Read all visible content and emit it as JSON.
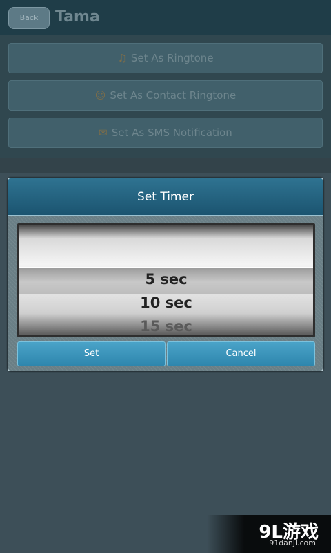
{
  "background": {
    "back_label": "Back",
    "title": "Tama",
    "buttons": [
      {
        "label": "Set As Ringtone",
        "icon": "ringtone-icon"
      },
      {
        "label": "Set As Contact Ringtone",
        "icon": "contact-icon"
      },
      {
        "label": "Set As SMS Notification",
        "icon": "sms-icon"
      }
    ]
  },
  "dialog": {
    "title": "Set Timer",
    "picker": {
      "items": [
        "",
        "5 sec",
        "10 sec",
        "15 sec"
      ],
      "selected": "5 sec"
    },
    "set_label": "Set",
    "cancel_label": "Cancel"
  },
  "watermark": {
    "logo": "9L游戏",
    "site": "91danji.com"
  },
  "colors": {
    "dialog_header": "#1b5470",
    "button_accent": "#2e86ad",
    "overlay": "#3d4f58"
  }
}
